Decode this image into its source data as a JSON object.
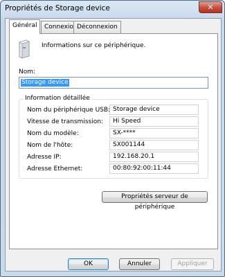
{
  "window": {
    "title": "Propriétés de Storage device"
  },
  "tabs": [
    {
      "label": "Général",
      "active": true
    },
    {
      "label": "Connexion",
      "active": false
    },
    {
      "label": "Déconnexion",
      "active": false
    }
  ],
  "general": {
    "info_text": "Informations sur ce périphérique.",
    "name_label": "Nom:",
    "name_value": "Storage device",
    "group_title": "Information détaillée",
    "fields": [
      {
        "label": "Nom du périphérique USB:",
        "value": "Storage device"
      },
      {
        "label": "Vitesse de transmission:",
        "value": "Hi Speed"
      },
      {
        "label": "Nom du modèle:",
        "value": "SX-****"
      },
      {
        "label": "Nom de l'hôte:",
        "value": "SX001144"
      },
      {
        "label": "Adresse IP:",
        "value": "192.168.20.1"
      },
      {
        "label": "Adresse Ethernet:",
        "value": "00:80:92:00:11:44"
      }
    ],
    "server_props_button": "Propriétés serveur de périphérique"
  },
  "buttons": {
    "ok": "OK",
    "cancel": "Annuler",
    "apply": "Appliquer"
  },
  "icons": {
    "close": "close-icon",
    "device": "storage-device-icon"
  }
}
